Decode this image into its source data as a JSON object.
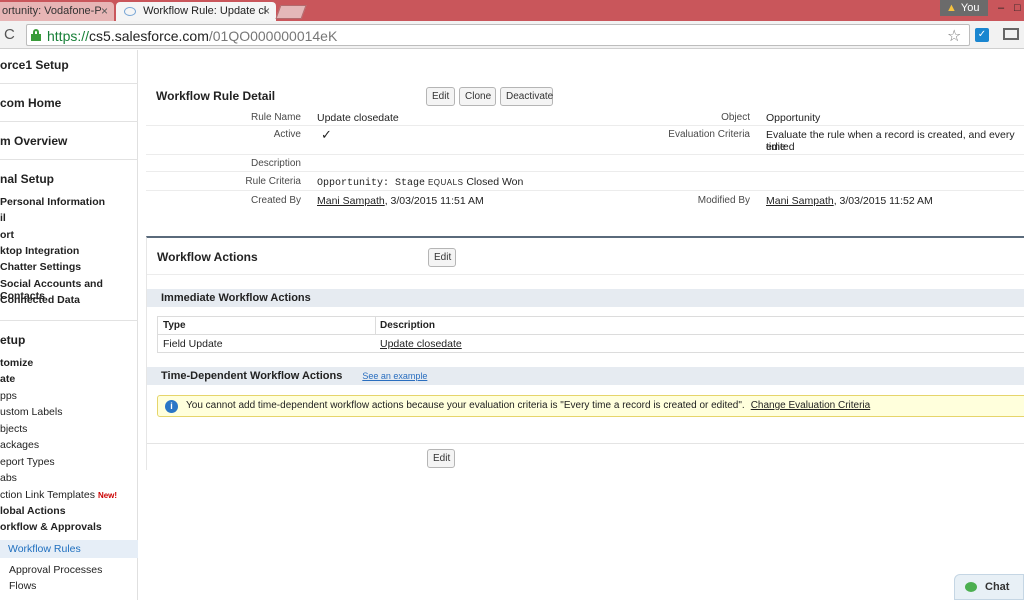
{
  "browser": {
    "tabs": [
      {
        "label": "ortunity: Vodafone-P",
        "active": false
      },
      {
        "label": "Workflow Rule: Update cl",
        "active": true
      }
    ],
    "profile_badge": "You",
    "url_scheme": "https://",
    "url_host": "cs5.salesforce.com",
    "url_path": "/01QO000000014eK",
    "close_glyph": "×",
    "reload_glyph": "C",
    "star_glyph": "☆"
  },
  "sidebar": {
    "sections": [
      {
        "label": "orce1 Setup"
      },
      {
        "label": "com Home"
      },
      {
        "label": "m Overview"
      },
      {
        "label": "nal Setup"
      },
      {
        "label": "etup"
      }
    ],
    "personal_items": [
      "Personal Information",
      "il",
      "ort",
      "ktop Integration",
      "Chatter Settings",
      "Social Accounts and Contacts",
      "Connected Data"
    ],
    "setup_items": [
      "tomize",
      "ate",
      "pps",
      "ustom Labels",
      "bjects",
      "ackages",
      "eport Types",
      "abs",
      "ction Link Templates",
      "lobal Actions",
      "orkflow & Approvals"
    ],
    "new_flag": "New!",
    "selected_item": "Workflow Rules",
    "sub_items": [
      "Approval Processes",
      "Flows"
    ]
  },
  "detail": {
    "title": "Workflow Rule Detail",
    "buttons": {
      "edit": "Edit",
      "clone": "Clone",
      "deactivate": "Deactivate"
    },
    "fields": {
      "rule_name_label": "Rule Name",
      "rule_name": "Update closedate",
      "object_label": "Object",
      "object": "Opportunity",
      "active_label": "Active",
      "active_check": "✓",
      "eval_label": "Evaluation Criteria",
      "eval_line1": "Evaluate the rule when a record is created, and every time",
      "eval_line2": "edited",
      "description_label": "Description",
      "criteria_label": "Rule Criteria",
      "criteria_mono": "Opportunity: Stage",
      "criteria_op": "EQUALS",
      "criteria_value": "Closed Won",
      "created_label": "Created By",
      "created_user": "Mani Sampath",
      "created_date": ", 3/03/2015 11:51 AM",
      "modified_label": "Modified By",
      "modified_user": "Mani Sampath",
      "modified_date": ", 3/03/2015 11:52 AM"
    }
  },
  "actions": {
    "title": "Workflow Actions",
    "edit": "Edit",
    "immediate_title": "Immediate Workflow Actions",
    "table_headers": [
      "Type",
      "Description"
    ],
    "rows": [
      {
        "type": "Field Update",
        "description": "Update closedate"
      }
    ],
    "time_dependent_title": "Time-Dependent Workflow Actions",
    "see_example": "See an example",
    "info_icon": "i",
    "info_text": "You cannot add time-dependent workflow actions because your evaluation criteria is \"Every time a record is created or edited\".",
    "change_link": "Change Evaluation Criteria",
    "bottom_edit": "Edit"
  },
  "chat": {
    "label": "Chat"
  }
}
